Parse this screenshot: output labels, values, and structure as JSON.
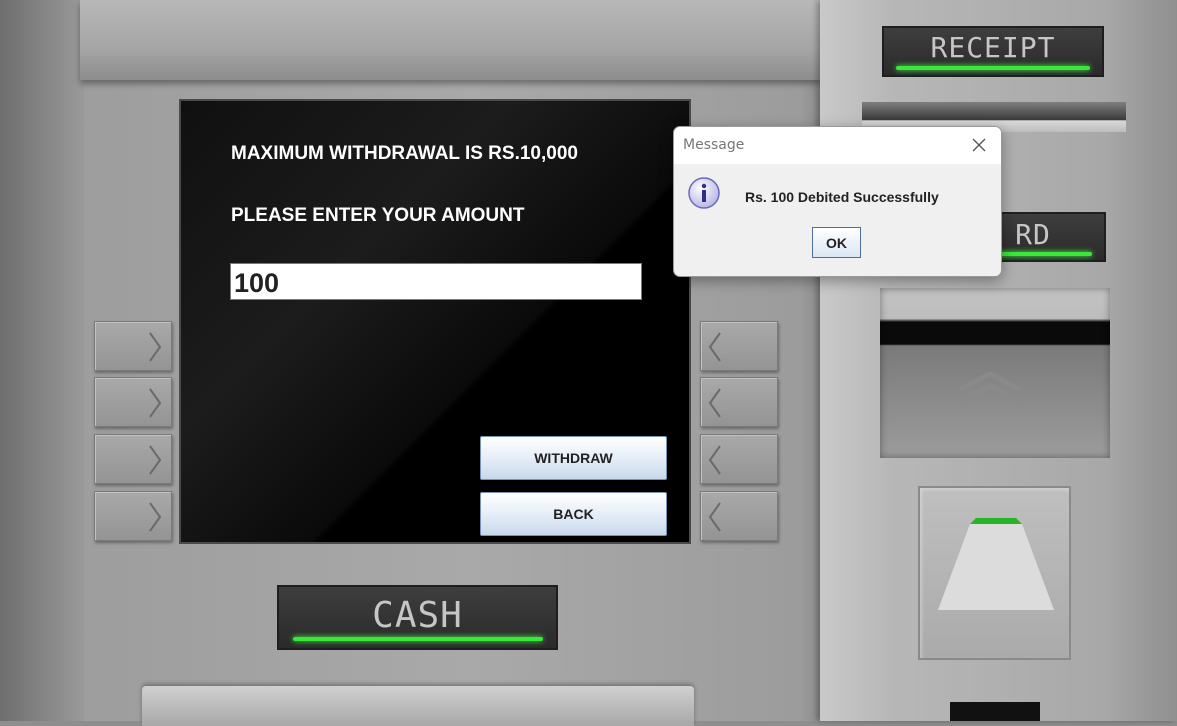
{
  "screen": {
    "max_label": "MAXIMUM WITHDRAWAL IS RS.10,000",
    "prompt_label": "PLEASE ENTER YOUR AMOUNT",
    "amount_value": "100",
    "withdraw_label": "WITHDRAW",
    "back_label": "BACK"
  },
  "panels": {
    "receipt_label": "RECEIPT",
    "card_label": "RD",
    "cash_label": "CASH",
    "led_color": "#39e839"
  },
  "dialog": {
    "title": "Message",
    "message": "Rs. 100 Debited Successfully",
    "ok_label": "OK",
    "icon": "info-icon"
  }
}
